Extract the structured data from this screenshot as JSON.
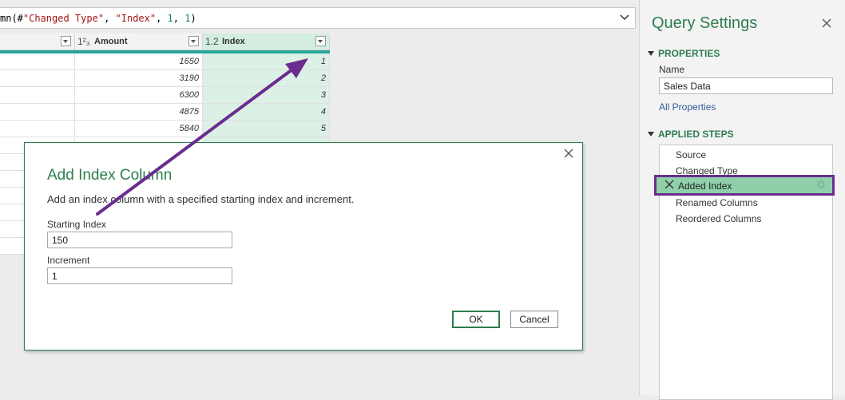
{
  "formula_bar": {
    "formula": "mn(#\"Changed Type\", \"Index\", 1, 1)",
    "prefix": "mn(#",
    "str1": "\"Changed Type\"",
    "sep1": ", ",
    "str2": "\"Index\"",
    "sep2": ", ",
    "num1": "1",
    "sep3": ", ",
    "num2": "1",
    "suffix": ")",
    "expand_icon": "chevron-down-icon"
  },
  "grid": {
    "columns": [
      {
        "type_icon": "",
        "name": ""
      },
      {
        "type_icon": "1²₃",
        "name": "Amount"
      },
      {
        "type_icon": "1.2",
        "name": "Index"
      }
    ],
    "rows": [
      {
        "amount": "1650",
        "index": "1"
      },
      {
        "amount": "3190",
        "index": "2"
      },
      {
        "amount": "6300",
        "index": "3"
      },
      {
        "amount": "4875",
        "index": "4"
      },
      {
        "amount": "5840",
        "index": "5"
      },
      {
        "amount": "",
        "index": ""
      },
      {
        "amount": "",
        "index": ""
      },
      {
        "amount": "",
        "index": ""
      },
      {
        "amount": "",
        "index": ""
      },
      {
        "amount": "",
        "index": ""
      },
      {
        "amount": "",
        "index": ""
      },
      {
        "amount": "",
        "index": ""
      }
    ],
    "accent_color": "#26a59a"
  },
  "dialog": {
    "title": "Add Index Column",
    "description": "Add an index column with a specified starting index and increment.",
    "starting_index_label": "Starting Index",
    "starting_index_value": "150",
    "increment_label": "Increment",
    "increment_value": "1",
    "ok_label": "OK",
    "cancel_label": "Cancel",
    "close_icon": "close-icon"
  },
  "query_settings": {
    "title": "Query Settings",
    "close_icon": "close-icon",
    "properties_heading": "PROPERTIES",
    "name_label": "Name",
    "name_value": "Sales Data",
    "all_properties_link": "All Properties",
    "applied_steps_heading": "APPLIED STEPS",
    "steps": [
      "Source",
      "Changed Type",
      "Added Index",
      "Renamed Columns",
      "Reordered Columns"
    ],
    "selected_step": "Added Index"
  },
  "annotation": {
    "arrow_color": "#6a2c8f",
    "highlight_color": "#6a2c8f"
  },
  "colors": {
    "brand_green": "#2e7d4f",
    "selected_step_bg": "#8fd0ab",
    "index_column_bg": "#dcf0e6"
  }
}
